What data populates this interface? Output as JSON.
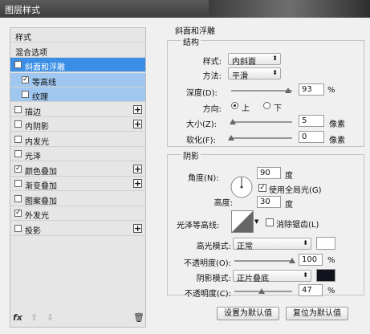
{
  "window": {
    "title": "图层样式"
  },
  "left_panel": {
    "items": [
      {
        "label": "样式",
        "kind": "header"
      },
      {
        "label": "混合选项",
        "kind": "header"
      },
      {
        "label": "斜面和浮雕",
        "checked": true,
        "selected": true
      },
      {
        "label": "等高线",
        "checked": true,
        "sub": true
      },
      {
        "label": "纹理",
        "checked": false,
        "sub": true
      },
      {
        "label": "描边",
        "checked": false,
        "plus": true
      },
      {
        "label": "内阴影",
        "checked": false,
        "plus": true
      },
      {
        "label": "内发光",
        "checked": false
      },
      {
        "label": "光泽",
        "checked": false
      },
      {
        "label": "颜色叠加",
        "checked": true,
        "plus": true
      },
      {
        "label": "渐变叠加",
        "checked": false,
        "plus": true
      },
      {
        "label": "图案叠加",
        "checked": false
      },
      {
        "label": "外发光",
        "checked": true
      },
      {
        "label": "投影",
        "checked": false,
        "plus": true
      }
    ],
    "footer": {
      "fx": "fx",
      "up": "⇧",
      "down": "⇩",
      "trash": "🗑"
    }
  },
  "bevel": {
    "title": "斜面和浮雕",
    "structure": {
      "title": "结构",
      "style_label": "样式:",
      "style_value": "内斜面",
      "technique_label": "方法:",
      "technique_value": "平滑",
      "depth_label": "深度(D):",
      "depth_value": "93",
      "depth_unit": "%",
      "depth_fraction": 0.93,
      "direction_label": "方向:",
      "dir_up": "上",
      "dir_down": "下",
      "direction_selected": "上",
      "size_label": "大小(Z):",
      "size_value": "5",
      "size_unit": "像素",
      "size_fraction": 0.03,
      "soften_label": "软化(F):",
      "soften_value": "0",
      "soften_unit": "像素",
      "soften_fraction": 0
    },
    "shading": {
      "title": "阴影",
      "angle_label": "角度(N):",
      "angle_value": "90",
      "angle_unit": "度",
      "global_light_label": "使用全局光(G)",
      "global_light": true,
      "altitude_label": "高度:",
      "altitude_value": "30",
      "altitude_unit": "度",
      "gloss_label": "光泽等高线:",
      "antialias_label": "消除锯齿(L)",
      "antialias": false,
      "highlight_mode_label": "高光模式:",
      "highlight_mode_value": "正常",
      "highlight_color": "#ffffff",
      "highlight_opacity_label": "不透明度(O):",
      "highlight_opacity_value": "100",
      "highlight_opacity_fraction": 1.0,
      "shadow_mode_label": "阴影模式:",
      "shadow_mode_value": "正片叠底",
      "shadow_color": "#10131c",
      "shadow_opacity_label": "不透明度(C):",
      "shadow_opacity_value": "47",
      "shadow_opacity_fraction": 0.47,
      "opacity_unit": "%"
    },
    "buttons": {
      "set_default": "设置为默认值",
      "reset_default": "复位为默认值"
    }
  }
}
